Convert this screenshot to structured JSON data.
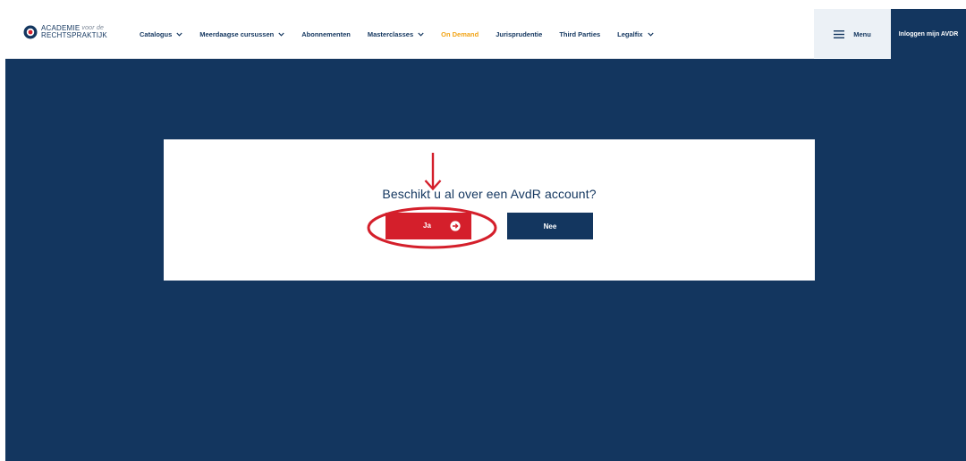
{
  "header": {
    "logo": {
      "line1": "ACADEMIE",
      "line1_small": "voor de",
      "line2": "RECHTSPRAKTIJK",
      "icon": "logo-icon"
    },
    "nav": [
      {
        "label": "Catalogus",
        "dropdown": true,
        "active": false
      },
      {
        "label": "Meerdaagse cursussen",
        "dropdown": true,
        "active": false
      },
      {
        "label": "Abonnementen",
        "dropdown": false,
        "active": false
      },
      {
        "label": "Masterclasses",
        "dropdown": true,
        "active": false
      },
      {
        "label": "On Demand",
        "dropdown": false,
        "active": true
      },
      {
        "label": "Jurisprudentie",
        "dropdown": false,
        "active": false
      },
      {
        "label": "Third Parties",
        "dropdown": false,
        "active": false
      },
      {
        "label": "Legalfix",
        "dropdown": true,
        "active": false
      }
    ],
    "menu_label": "Menu",
    "menu_icon": "hamburger-icon",
    "login_label": "Inloggen mijn AVDR"
  },
  "card": {
    "question": "Beschikt u al over een AvdR account?",
    "yes_label": "Ja",
    "yes_icon": "arrow-right-circle-icon",
    "no_label": "Nee"
  },
  "annotation": {
    "arrow_icon": "down-arrow-icon",
    "highlight": "red-ellipse"
  },
  "colors": {
    "navy": "#13365f",
    "red": "#d41f2b",
    "accent_orange": "#f2a417",
    "menu_bg": "#ecf1f6"
  }
}
